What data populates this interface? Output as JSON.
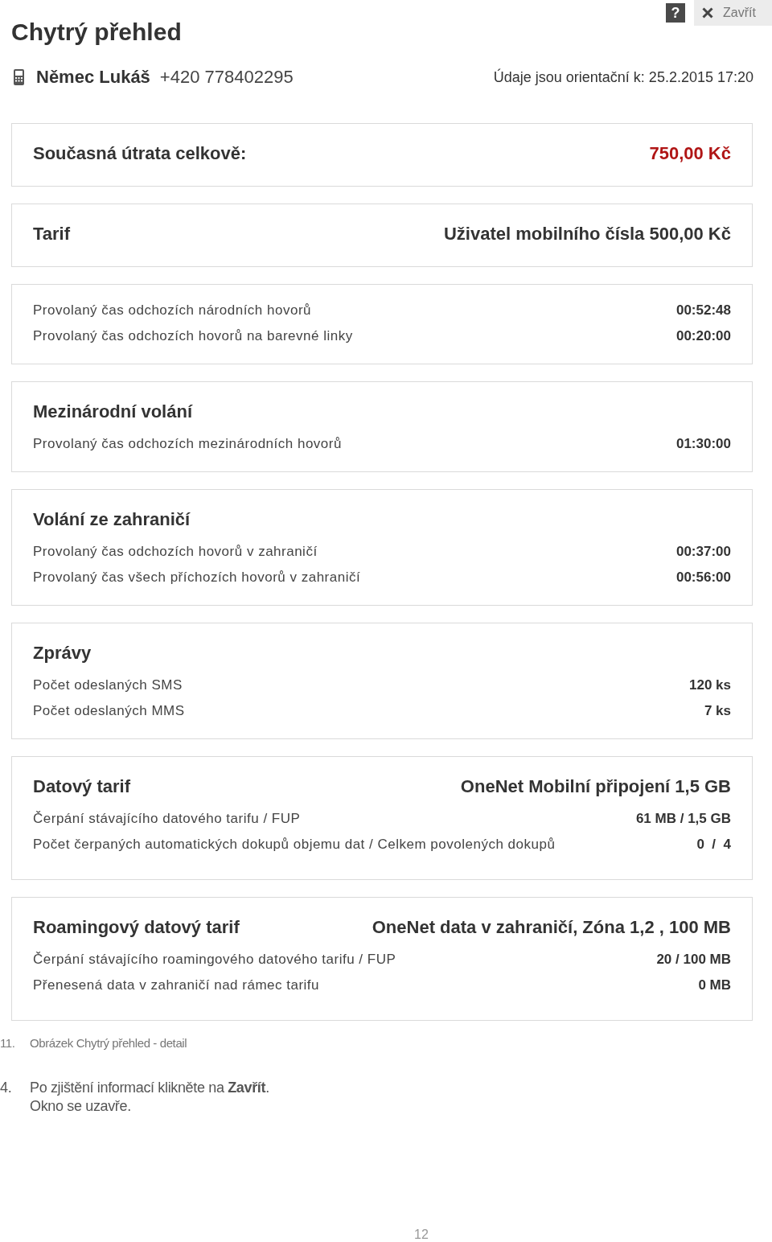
{
  "header": {
    "help_button": "?",
    "close_button": "Zavřít"
  },
  "title": "Chytrý přehled",
  "subscriber": {
    "name": "Němec Lukáš",
    "phone": "+420 778402295",
    "as_of": "Údaje jsou orientační k: 25.2.2015 17:20"
  },
  "cards": [
    {
      "title": "Současná útrata celkově:",
      "value": "750,00 Kč",
      "highlighted": true
    },
    {
      "title": "Tarif",
      "value": "Uživatel mobilního čísla 500,00 Kč",
      "highlighted": false
    },
    {
      "rows": [
        {
          "label": "Provolaný čas odchozích národních hovorů",
          "value": "00:52:48"
        },
        {
          "label": "Provolaný čas odchozích hovorů na barevné linky",
          "value": "00:20:00"
        }
      ]
    },
    {
      "title": "Mezinárodní volání",
      "rows": [
        {
          "label": "Provolaný čas odchozích mezinárodních hovorů",
          "value": "01:30:00"
        }
      ]
    },
    {
      "title": "Volání ze zahraničí",
      "rows": [
        {
          "label": "Provolaný čas odchozích hovorů v zahraničí",
          "value": "00:37:00"
        },
        {
          "label": "Provolaný čas všech příchozích hovorů v zahraničí",
          "value": "00:56:00"
        }
      ]
    },
    {
      "title": "Zprávy",
      "rows": [
        {
          "label": "Počet odeslaných SMS",
          "value": "120 ks"
        },
        {
          "label": "Počet odeslaných MMS",
          "value": "7 ks"
        }
      ]
    },
    {
      "title": "Datový tarif",
      "value": "OneNet Mobilní připojení 1,5 GB",
      "highlighted": false,
      "rows": [
        {
          "label": "Čerpání stávajícího datového tarifu / FUP",
          "value": "61 MB / 1,5 GB"
        },
        {
          "label": "Počet čerpaných automatických dokupů objemu dat / Celkem povolených dokupů",
          "value": "0  /  4"
        }
      ]
    },
    {
      "title": "Roamingový datový tarif",
      "value": "OneNet data v zahraničí, Zóna 1,2 , 100 MB",
      "highlighted": false,
      "rows": [
        {
          "label": "Čerpání stávajícího roamingového datového tarifu / FUP",
          "value": "20 / 100 MB"
        },
        {
          "label": "Přenesená data v zahraničí nad rámec tarifu",
          "value": "0 MB"
        }
      ]
    }
  ],
  "caption": {
    "number": "11.",
    "text": "Obrázek Chytrý přehled - detail"
  },
  "steps": [
    {
      "number": "4.",
      "lines": [
        "Po zjištění informací klikněte na **Zavřít**.",
        "Okno se uzavře."
      ]
    }
  ],
  "page_number": "12"
}
